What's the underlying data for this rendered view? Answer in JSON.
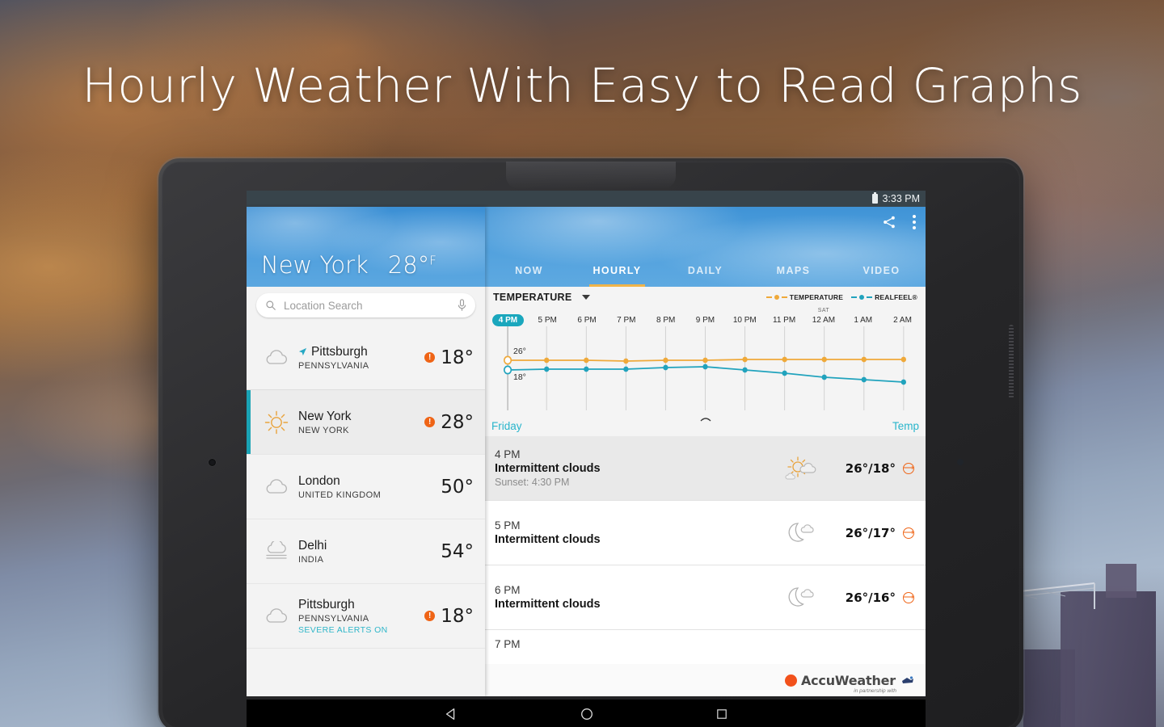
{
  "promo": {
    "headline": "Hourly Weather With Easy to Read Graphs"
  },
  "status_bar": {
    "time": "3:33 PM",
    "battery_icon": "battery-icon"
  },
  "left_panel": {
    "hero": {
      "city": "New York",
      "temp": "28°",
      "unit": "F"
    },
    "search": {
      "placeholder": "Location Search",
      "search_icon": "search-icon",
      "mic_icon": "microphone-icon"
    },
    "cities": [
      {
        "name": "Pittsburgh",
        "region": "PENNSYLVANIA",
        "temp": "18°",
        "icon": "cloudy-icon",
        "alert": true,
        "alert_mark": "!",
        "located": true,
        "alert_text": "",
        "selected": false
      },
      {
        "name": "New York",
        "region": "NEW YORK",
        "temp": "28°",
        "icon": "sunny-icon",
        "alert": true,
        "alert_mark": "!",
        "located": false,
        "alert_text": "",
        "selected": true
      },
      {
        "name": "London",
        "region": "UNITED KINGDOM",
        "temp": "50°",
        "icon": "cloudy-icon",
        "alert": false,
        "alert_mark": "",
        "located": false,
        "alert_text": "",
        "selected": false
      },
      {
        "name": "Delhi",
        "region": "INDIA",
        "temp": "54°",
        "icon": "haze-icon",
        "alert": false,
        "alert_mark": "",
        "located": false,
        "alert_text": "",
        "selected": false
      },
      {
        "name": "Pittsburgh",
        "region": "PENNSYLVANIA",
        "temp": "18°",
        "icon": "cloudy-icon",
        "alert": true,
        "alert_mark": "!",
        "located": false,
        "alert_text": "SEVERE ALERTS ON",
        "selected": false
      }
    ]
  },
  "right_panel": {
    "actions": {
      "share_icon": "share-icon",
      "overflow_icon": "overflow-menu-icon"
    },
    "tabs": [
      {
        "label": "NOW",
        "active": false
      },
      {
        "label": "HOURLY",
        "active": true
      },
      {
        "label": "DAILY",
        "active": false
      },
      {
        "label": "MAPS",
        "active": false
      },
      {
        "label": "VIDEO",
        "active": false
      }
    ],
    "chart": {
      "metric_label": "TEMPERATURE",
      "dropdown_icon": "chevron-down-icon",
      "day_label": "Friday",
      "metric_link": "Temp",
      "expand_icon": "chevron-up-icon"
    },
    "hourly": [
      {
        "time": "4 PM",
        "condition": "Intermittent clouds",
        "extra": "Sunset: 4:30 PM",
        "icon": "sun-behind-cloud-icon",
        "temps": "26°/18°",
        "arrow_icon": "arrow-right-circle-icon",
        "shaded": true
      },
      {
        "time": "5 PM",
        "condition": "Intermittent clouds",
        "extra": "",
        "icon": "moon-behind-cloud-icon",
        "temps": "26°/17°",
        "arrow_icon": "arrow-right-circle-icon",
        "shaded": false
      },
      {
        "time": "6 PM",
        "condition": "Intermittent clouds",
        "extra": "",
        "icon": "moon-behind-cloud-icon",
        "temps": "26°/16°",
        "arrow_icon": "arrow-right-circle-icon",
        "shaded": false
      },
      {
        "time": "7 PM",
        "condition": "",
        "extra": "",
        "icon": "",
        "temps": "",
        "arrow_icon": "",
        "shaded": false
      }
    ],
    "footer": {
      "brand": "AccuWeather",
      "partner_text": "in partnership with",
      "sun_icon": "accuweather-sun-icon",
      "partner_icon": "partner-badge-icon"
    }
  },
  "nav_bar": {
    "back_icon": "back-triangle-icon",
    "home_icon": "home-circle-icon",
    "recents_icon": "recents-square-icon"
  },
  "colors": {
    "temperature_line": "#efa93a",
    "realfeel_line": "#21a3bd",
    "accent_teal": "#1aa7bd",
    "accent_orange": "#ef6416",
    "tab_underline": "#f0b44a",
    "hero_blue": "#4d9ddc"
  },
  "chart_data": {
    "type": "line",
    "title": "TEMPERATURE",
    "xlabel": "",
    "ylabel": "",
    "grid": true,
    "legend_position": "top-right",
    "x": [
      "4 PM",
      "5 PM",
      "6 PM",
      "7 PM",
      "8 PM",
      "9 PM",
      "10 PM",
      "11 PM",
      "12 AM",
      "1 AM",
      "2 AM"
    ],
    "x_day_labels": [
      "",
      "",
      "",
      "",
      "",
      "",
      "",
      "",
      "SAT",
      "",
      ""
    ],
    "selected_x": "4 PM",
    "ylim": [
      14,
      30
    ],
    "y_annotations": [
      {
        "label": "26°",
        "value": 26,
        "series": "TEMPERATURE"
      },
      {
        "label": "18°",
        "value": 18,
        "series": "REALFEEL®"
      }
    ],
    "series": [
      {
        "name": "TEMPERATURE",
        "color": "#efa93a",
        "values": [
          26,
          26,
          26,
          26,
          26,
          26,
          26,
          26,
          26,
          26,
          26
        ]
      },
      {
        "name": "REALFEEL®",
        "color": "#21a3bd",
        "values": [
          18,
          18,
          18,
          18,
          18.3,
          18.4,
          17.8,
          17.2,
          16.6,
          16.2,
          15.8
        ]
      }
    ],
    "footer_left": "Friday",
    "footer_right": "Temp"
  }
}
